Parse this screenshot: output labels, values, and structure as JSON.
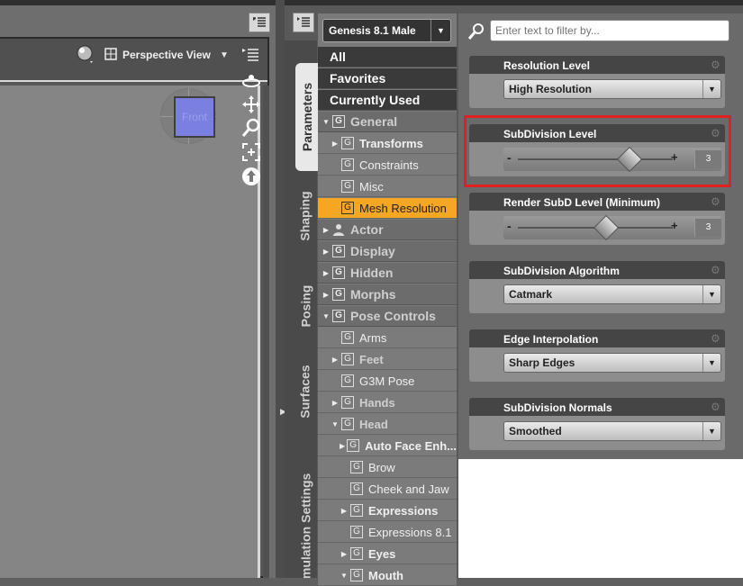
{
  "viewport": {
    "camera_label": "Perspective View",
    "cube_face": "Front"
  },
  "figure_selector": {
    "value": "Genesis 8.1 Male"
  },
  "vertical_tabs": [
    "Parameters",
    "Shaping",
    "Posing",
    "Surfaces",
    "Simulation Settings"
  ],
  "tree": {
    "top_items": [
      "All",
      "Favorites",
      "Currently Used"
    ],
    "items": [
      {
        "label": "General",
        "level": 0,
        "expanded": true
      },
      {
        "label": "Transforms",
        "level": 1,
        "collapsed": true,
        "bold": true
      },
      {
        "label": "Constraints",
        "level": 1
      },
      {
        "label": "Misc",
        "level": 1
      },
      {
        "label": "Mesh Resolution",
        "level": 1,
        "selected": true
      },
      {
        "label": "Actor",
        "level": 0,
        "collapsed": true,
        "icon": "person-icon"
      },
      {
        "label": "Display",
        "level": 0,
        "collapsed": true
      },
      {
        "label": "Hidden",
        "level": 0,
        "collapsed": true
      },
      {
        "label": "Morphs",
        "level": 0,
        "collapsed": true
      },
      {
        "label": "Pose Controls",
        "level": 0,
        "expanded": true
      },
      {
        "label": "Arms",
        "level": 1
      },
      {
        "label": "Feet",
        "level": 1,
        "collapsed": true,
        "dim": true
      },
      {
        "label": "G3M Pose",
        "level": 1
      },
      {
        "label": "Hands",
        "level": 1,
        "collapsed": true,
        "dim": true
      },
      {
        "label": "Head",
        "level": 1,
        "expanded": true,
        "dim": true
      },
      {
        "label": "Auto Face Enh...",
        "level": 2,
        "collapsed": true,
        "bold": true
      },
      {
        "label": "Brow",
        "level": 2
      },
      {
        "label": "Cheek and Jaw",
        "level": 2
      },
      {
        "label": "Expressions",
        "level": 2,
        "collapsed": true,
        "bold": true
      },
      {
        "label": "Expressions 8.1",
        "level": 2
      },
      {
        "label": "Eyes",
        "level": 2,
        "collapsed": true,
        "bold": true
      },
      {
        "label": "Mouth",
        "level": 2,
        "expanded": true,
        "bold": true
      }
    ]
  },
  "filter": {
    "placeholder": "Enter text to filter by..."
  },
  "properties": [
    {
      "title": "Resolution Level",
      "type": "dropdown",
      "value": "High Resolution"
    },
    {
      "title": "SubDivision Level",
      "type": "slider",
      "value": "3",
      "fraction": 0.72,
      "highlighted": true
    },
    {
      "title": "Render SubD Level (Minimum)",
      "type": "slider",
      "value": "3",
      "fraction": 0.57
    },
    {
      "title": "SubDivision Algorithm",
      "type": "dropdown",
      "value": "Catmark"
    },
    {
      "title": "Edge Interpolation",
      "type": "dropdown",
      "value": "Sharp Edges"
    },
    {
      "title": "SubDivision Normals",
      "type": "dropdown",
      "value": "Smoothed"
    }
  ],
  "colors": {
    "selected": "#f5a623",
    "highlight": "#e02020"
  }
}
